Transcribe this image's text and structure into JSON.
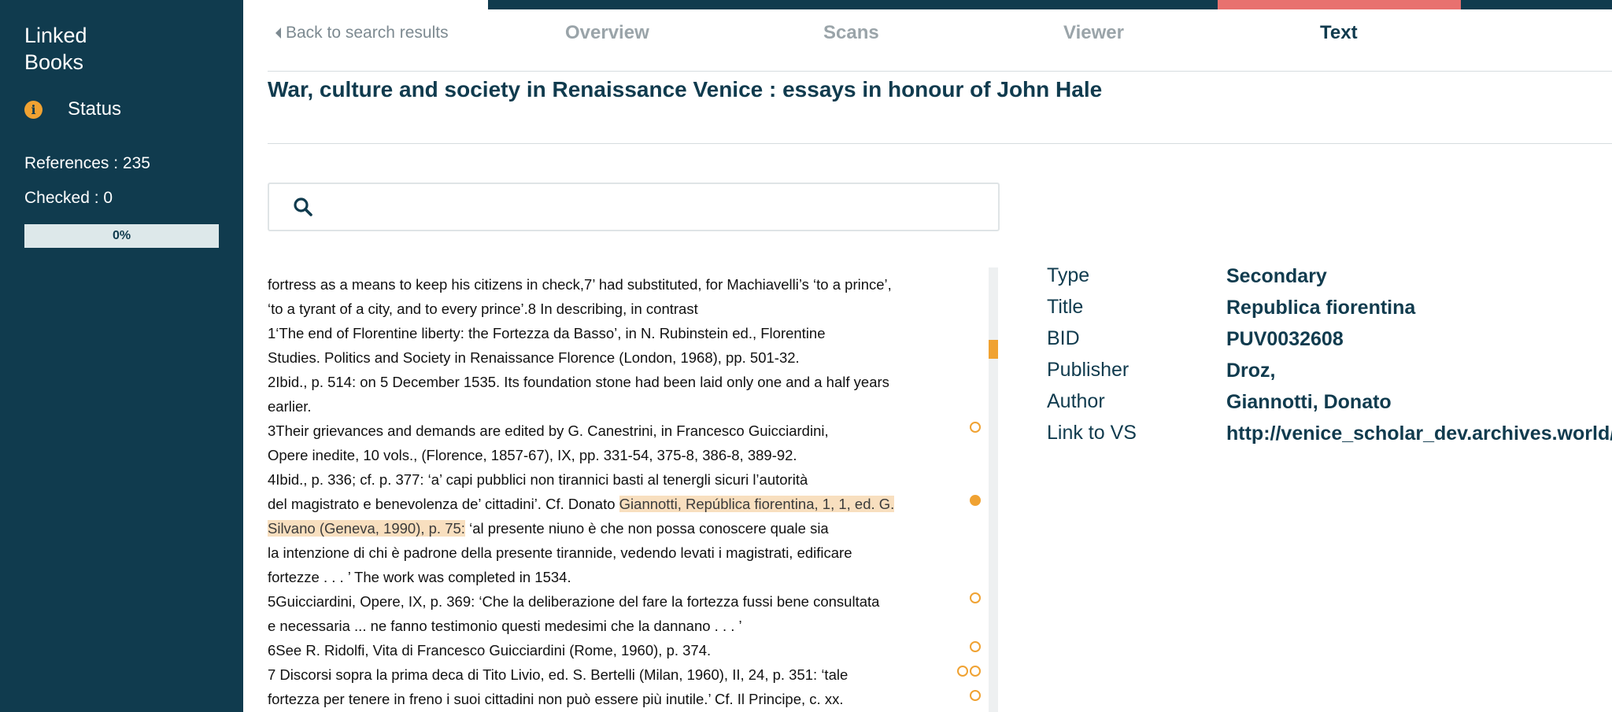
{
  "sidebar": {
    "logo_line1": "Linked",
    "logo_line2": "Books",
    "status_icon": "info-icon",
    "status_label": "Status",
    "references": "References : 235",
    "checked": "Checked : 0",
    "progress_text": "0%",
    "progress_value": 0
  },
  "nav": {
    "back_label": "Back to search results",
    "tabs": [
      {
        "label": "Overview"
      },
      {
        "label": "Scans"
      },
      {
        "label": "Viewer"
      },
      {
        "label": "Text"
      }
    ],
    "active_tab": "Text"
  },
  "book": {
    "title": "War, culture and society in Renaissance Venice : essays in honour of John Hale"
  },
  "search": {
    "placeholder": "",
    "value": ""
  },
  "text_lines": [
    {
      "text": "fortress as a means to keep his citizens in check,7’ had substituted, for Machiavelli’s ‘to a prince’,"
    },
    {
      "text": "‘to a tyrant of a city, and to every prince’.8 In describing, in contrast"
    },
    {
      "text": "1‘The end of Florentine liberty: the Fortezza da Basso’, in N. Rubinstein ed., Florentine"
    },
    {
      "text": "Studies. Politics and Society in Renaissance Florence (London, 1968), pp. 501-32."
    },
    {
      "text": "2Ibid., p. 514: on 5 December 1535. Its foundation stone had been laid only one and a half years"
    },
    {
      "text": "earlier."
    },
    {
      "text": "3Their grievances and demands are edited by G. Canestrini, in Francesco Guicciardini,"
    },
    {
      "text": "Opere inedite, 10 vols., (Florence, 1857-67), IX, pp. 331-54, 375-8, 386-8, 389-92."
    },
    {
      "text": "4Ibid., p. 336; cf. p. 377: ‘a’ capi pubblici non tirannici basti al tenergli sicuri l’autorità"
    },
    {
      "text_before": "del magistrato e benevolenza de’ cittadini’. Cf. Donato ",
      "highlight": "Giannotti, República fiorentina, 1, 1, ed. G."
    },
    {
      "highlight": "Silvano (Geneva, 1990), p. 75:",
      "text_after": " ‘al presente niuno è che non possa conoscere quale sia"
    },
    {
      "text": "la intenzione di chi è padrone della presente tirannide, vedendo levati i magistrati, edificare"
    },
    {
      "text": "fortezze . . . ’ The work was completed in 1534."
    },
    {
      "text": "5Guicciardini, Opere, IX, p. 369: ‘Che la deliberazione del fare la fortezza fussi bene consultata"
    },
    {
      "text": "e necessaria ... ne fanno testimonio questi medesimi che la dannano . . . ’"
    },
    {
      "text": "6See R. Ridolfi, Vita di Francesco Guicciardini  (Rome, 1960), p. 374."
    },
    {
      "text": "7 Discorsi sopra la prima deca di Tito Livio, ed. S. Bertelli (Milan, 1960), II, 24, p. 351: ‘tale"
    },
    {
      "text": "fortezza per tenere in freno i suoi cittadini non può essere più inutile.’ Cf. Il Principe, c. xx."
    }
  ],
  "details": [
    {
      "label": "Type",
      "value": "Secondary"
    },
    {
      "label": "Title",
      "value": "Republica fiorentina"
    },
    {
      "label": "BID",
      "value": "PUV0032608"
    },
    {
      "label": "Publisher",
      "value": "Droz,"
    },
    {
      "label": "Author",
      "value": "Giannotti, Donato"
    },
    {
      "label": "Link to VS",
      "value": "http://venice_scholar_dev.archives.world/"
    }
  ],
  "colors": {
    "sidebar_bg": "#103b4e",
    "accent_orange": "#f0a232",
    "accent_tab": "#e8716f",
    "highlight": "#f8dfbf"
  }
}
